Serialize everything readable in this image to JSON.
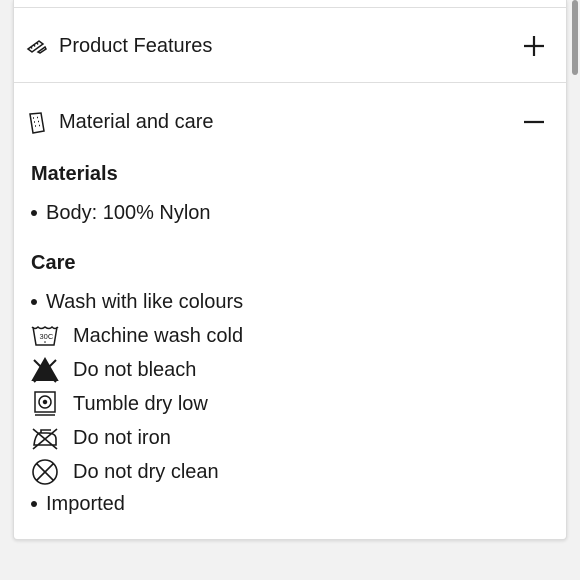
{
  "accordion": {
    "product_features": {
      "title": "Product Features",
      "icon": "ruler-pencil-icon",
      "state": "collapsed"
    },
    "material_and_care": {
      "title": "Material and care",
      "icon": "care-label-icon",
      "state": "expanded"
    }
  },
  "materials": {
    "heading": "Materials",
    "items": [
      "Body: 100% Nylon"
    ]
  },
  "care": {
    "heading": "Care",
    "bullets_before": [
      "Wash with like colours"
    ],
    "instructions": [
      {
        "label": "Machine wash cold",
        "icon": "machine-wash-30c-icon"
      },
      {
        "label": "Do not bleach",
        "icon": "do-not-bleach-icon"
      },
      {
        "label": "Tumble dry low",
        "icon": "tumble-dry-low-icon"
      },
      {
        "label": "Do not iron",
        "icon": "do-not-iron-icon"
      },
      {
        "label": "Do not dry clean",
        "icon": "do-not-dry-clean-icon"
      }
    ],
    "bullets_after": [
      "Imported"
    ],
    "wash_temp_label": "30C"
  }
}
